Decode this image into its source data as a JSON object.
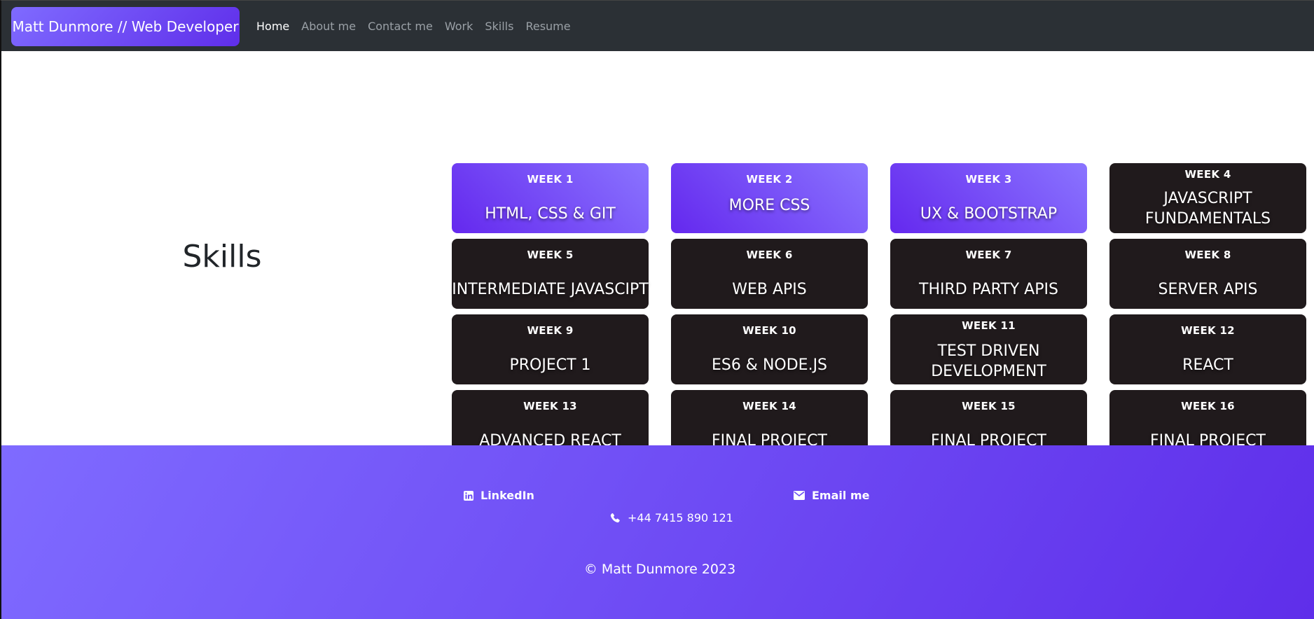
{
  "navbar": {
    "brand": "Matt Dunmore // Web Developer",
    "links": [
      {
        "label": "Home",
        "active": true
      },
      {
        "label": "About me",
        "active": false
      },
      {
        "label": "Contact me",
        "active": false
      },
      {
        "label": "Work",
        "active": false
      },
      {
        "label": "Skills",
        "active": false
      },
      {
        "label": "Resume",
        "active": false
      }
    ]
  },
  "main": {
    "heading": "Skills",
    "cards": [
      {
        "week": "WEEK 1",
        "title": "HTML, CSS & GIT",
        "highlight": true
      },
      {
        "week": "WEEK 2",
        "title": "MORE CSS",
        "highlight": true
      },
      {
        "week": "WEEK 3",
        "title": "UX & BOOTSTRAP",
        "highlight": true
      },
      {
        "week": "WEEK 4",
        "title": "JAVASCRIPT FUNDAMENTALS",
        "highlight": false
      },
      {
        "week": "WEEK 5",
        "title": "INTERMEDIATE JAVASCIPT",
        "highlight": false
      },
      {
        "week": "WEEK 6",
        "title": "WEB APIS",
        "highlight": false
      },
      {
        "week": "WEEK 7",
        "title": "THIRD PARTY APIS",
        "highlight": false
      },
      {
        "week": "WEEK 8",
        "title": "SERVER APIS",
        "highlight": false
      },
      {
        "week": "WEEK 9",
        "title": "PROJECT 1",
        "highlight": false
      },
      {
        "week": "WEEK 10",
        "title": "ES6 & NODE.JS",
        "highlight": false
      },
      {
        "week": "WEEK 11",
        "title": "TEST DRIVEN DEVELOPMENT",
        "highlight": false
      },
      {
        "week": "WEEK 12",
        "title": "REACT",
        "highlight": false
      },
      {
        "week": "WEEK 13",
        "title": "ADVANCED REACT",
        "highlight": false
      },
      {
        "week": "WEEK 14",
        "title": "FINAL PROJECT",
        "highlight": false
      },
      {
        "week": "WEEK 15",
        "title": "FINAL PROJECT",
        "highlight": false
      },
      {
        "week": "WEEK 16",
        "title": "FINAL PROJECT",
        "highlight": false
      }
    ]
  },
  "footer": {
    "linkedin": "LinkedIn",
    "email": "Email me",
    "phone": "+44 7415 890 121",
    "copyright": "© Matt Dunmore 2023",
    "icons": {
      "linkedin": "linkedin-icon",
      "email": "envelope-icon",
      "phone": "phone-icon"
    }
  },
  "colors": {
    "navbar_bg": "#2b3035",
    "accent_start": "#7f6bff",
    "accent_end": "#5f2eea",
    "card_dark": "#201a1c"
  }
}
